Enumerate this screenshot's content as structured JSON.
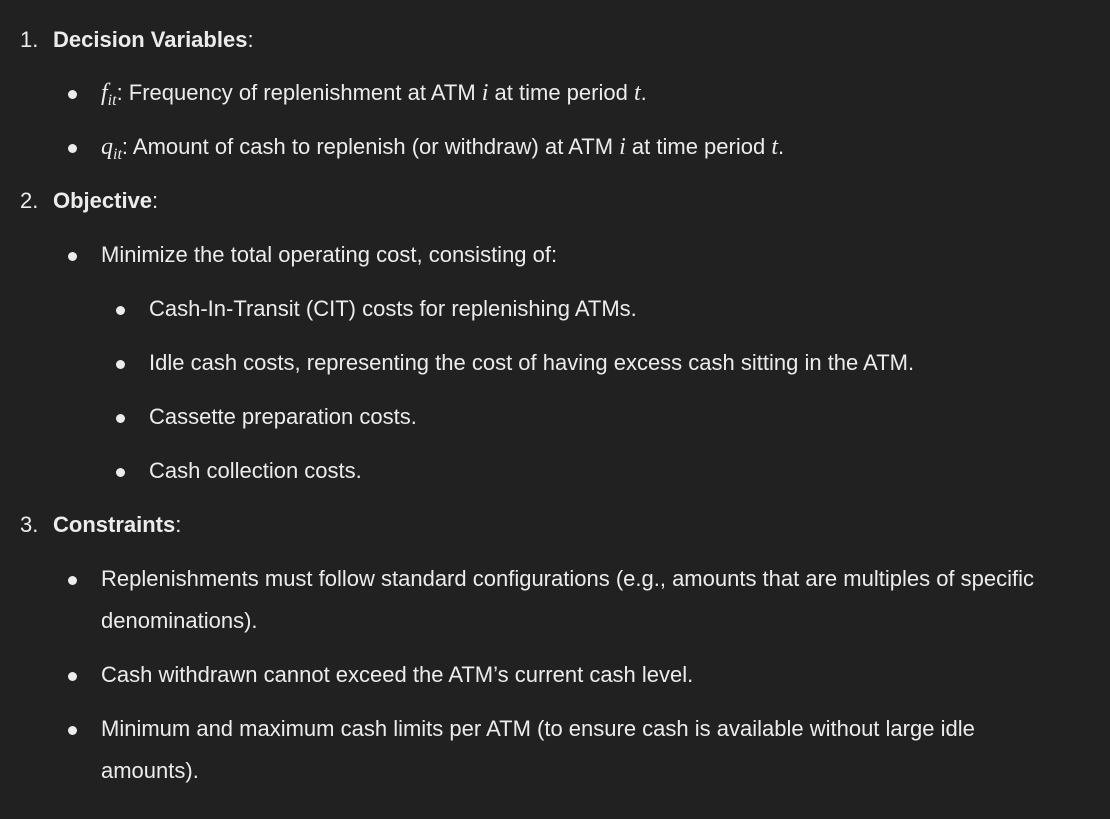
{
  "sections": [
    {
      "number": "1.",
      "title": "Decision Variables",
      "suffix": ":",
      "items": [
        {
          "var": "f",
          "sub": "it",
          "text": ": Frequency of replenishment at ATM ",
          "m1": "i",
          "text2": " at time period ",
          "m2": "t",
          "end": "."
        },
        {
          "var": "q",
          "sub": "it",
          "text": ": Amount of cash to replenish (or withdraw) at ATM ",
          "m1": "i",
          "text2": " at time period ",
          "m2": "t",
          "end": "."
        }
      ]
    },
    {
      "number": "2.",
      "title": "Objective",
      "suffix": ":",
      "items": [
        {
          "text": "Minimize the total operating cost, consisting of:"
        }
      ],
      "subitems": [
        {
          "text": "Cash-In-Transit (CIT) costs for replenishing ATMs."
        },
        {
          "text": "Idle cash costs, representing the cost of having excess cash sitting in the ATM."
        },
        {
          "text": "Cassette preparation costs."
        },
        {
          "text": "Cash collection costs."
        }
      ]
    },
    {
      "number": "3.",
      "title": "Constraints",
      "suffix": ":",
      "items": [
        {
          "text": "Replenishments must follow standard configurations (e.g., amounts that are multiples of specific denominations)."
        },
        {
          "text": "Cash withdrawn cannot exceed the ATM’s current cash level."
        },
        {
          "text": "Minimum and maximum cash limits per ATM (to ensure cash is available without large idle amounts)."
        }
      ]
    }
  ]
}
